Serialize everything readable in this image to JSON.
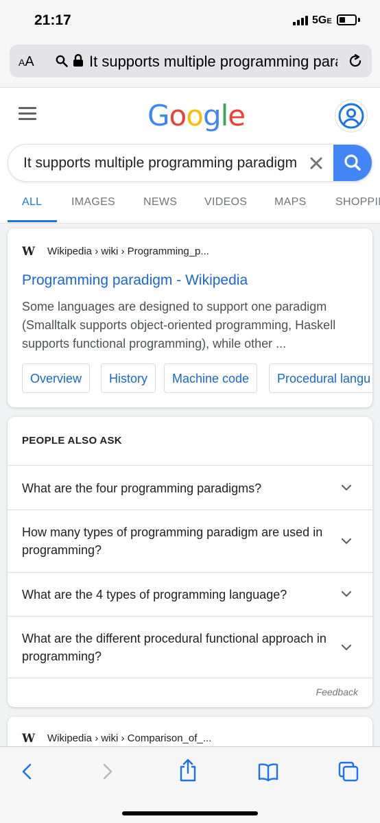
{
  "status_bar": {
    "time": "21:17",
    "network": "5G",
    "network_suffix": "E"
  },
  "url_bar": {
    "text_size_label": "AA",
    "url_text": "It supports multiple programming paradigm"
  },
  "google": {
    "logo_letters": [
      "G",
      "o",
      "o",
      "g",
      "l",
      "e"
    ],
    "logo_colors": [
      "#4285f4",
      "#ea4335",
      "#fbbc05",
      "#4285f4",
      "#34a853",
      "#ea4335"
    ],
    "search_query": "It supports multiple programming paradigm",
    "tabs": [
      "ALL",
      "IMAGES",
      "NEWS",
      "VIDEOS",
      "MAPS",
      "SHOPPING"
    ]
  },
  "result1": {
    "source_icon": "W",
    "breadcrumb": "Wikipedia › wiki › Programming_p...",
    "title": "Programming paradigm - Wikipedia",
    "snippet": "Some languages are designed to support one paradigm (Smalltalk supports object-oriented programming, Haskell supports functional programming), while other ...",
    "chips": [
      "Overview",
      "History",
      "Machine code",
      "Procedural langu"
    ]
  },
  "people_also_ask": {
    "heading": "PEOPLE ALSO ASK",
    "questions": [
      "What are the four programming paradigms?",
      "How many types of programming paradigm are used in programming?",
      "What are the 4 types of programming language?",
      "What are the different procedural functional approach in programming?"
    ],
    "feedback": "Feedback"
  },
  "result2": {
    "source_icon": "W",
    "breadcrumb": "Wikipedia › wiki › Comparison_of_..."
  },
  "colors": {
    "accent": "#1a73e8",
    "link": "#1967d2",
    "search_button": "#4285f4"
  },
  "toolbar_icons": [
    "back-icon",
    "forward-icon",
    "share-icon",
    "bookmarks-icon",
    "tabs-icon"
  ]
}
